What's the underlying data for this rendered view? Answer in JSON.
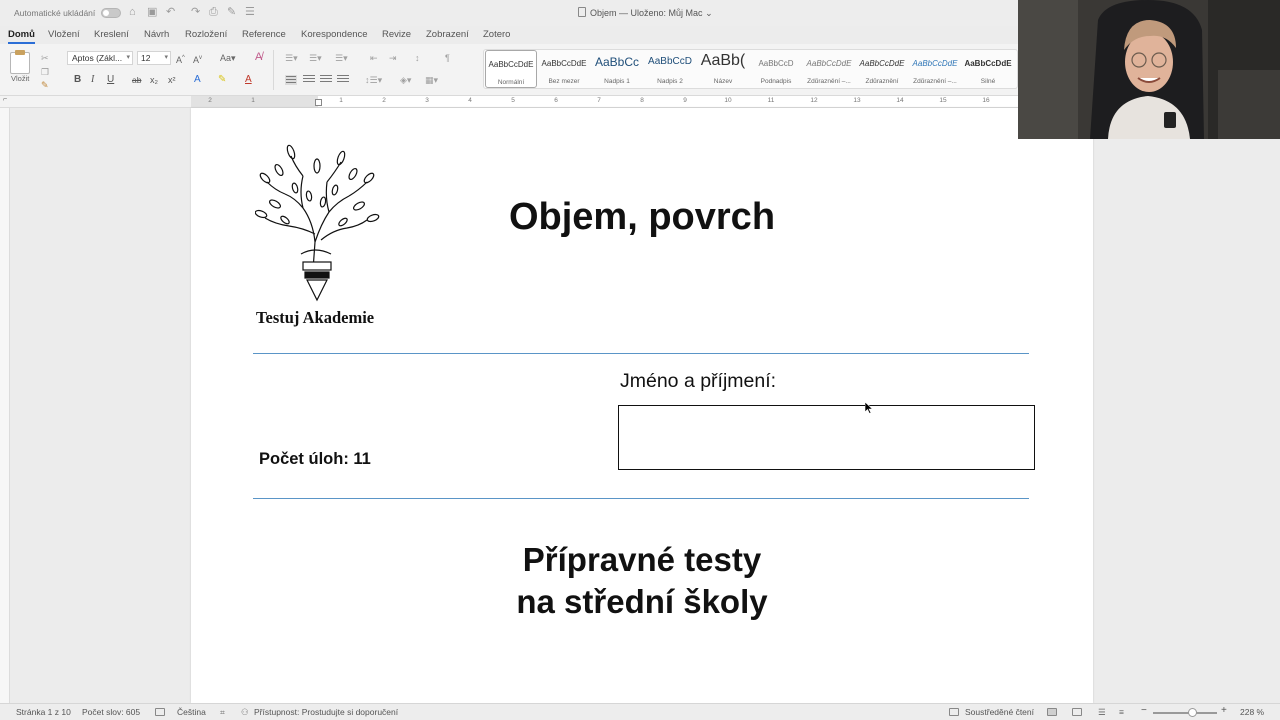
{
  "titlebar": {
    "autosave_label": "Automatické ukládání",
    "document_title": "Objem — Uloženo: Můj Mac",
    "dropdown_glyph": "⌄"
  },
  "ribbon_tabs": [
    "Domů",
    "Vložení",
    "Kreslení",
    "Návrh",
    "Rozložení",
    "Reference",
    "Korespondence",
    "Revize",
    "Zobrazení",
    "Zotero"
  ],
  "ribbon": {
    "paste_label": "Vložit",
    "font_name": "Aptos (Zákl...",
    "font_size": "12",
    "format_buttons": [
      "B",
      "I",
      "U",
      "ab",
      "x₂",
      "x²"
    ],
    "styles": [
      {
        "preview": "AaBbCcDdE",
        "name": "Normální"
      },
      {
        "preview": "AaBbCcDdE",
        "name": "Bez mezer"
      },
      {
        "preview": "AaBbCc",
        "name": "Nadpis 1"
      },
      {
        "preview": "AaBbCcD",
        "name": "Nadpis 2"
      },
      {
        "preview": "AaBb(",
        "name": "Název"
      },
      {
        "preview": "AaBbCcD",
        "name": "Podnadpis"
      },
      {
        "preview": "AaBbCcDdE",
        "name": "Zdůraznění –..."
      },
      {
        "preview": "AaBbCcDdE",
        "name": "Zdůraznění"
      },
      {
        "preview": "AaBbCcDdE",
        "name": "Zdůraznění –..."
      },
      {
        "preview": "AaBbCcDdE",
        "name": "Silné"
      }
    ]
  },
  "ruler": {
    "numbers": [
      "2",
      "1",
      "1",
      "2",
      "3",
      "4",
      "5",
      "6",
      "7",
      "8",
      "9",
      "10",
      "11",
      "12",
      "13",
      "14",
      "15",
      "16"
    ]
  },
  "document": {
    "logo_text": "Testuj Akademie",
    "title": "Objem, povrch",
    "name_label": "Jméno a příjmení:",
    "task_count": "Počet úloh: 11",
    "subtitle_line1": "Přípravné testy",
    "subtitle_line2": "na střední školy"
  },
  "statusbar": {
    "page": "Stránka 1 z 10",
    "word_count": "Počet slov: 605",
    "language": "Čeština",
    "accessibility": "Přístupnost: Prostudujte si doporučení",
    "focus": "Soustředěné čtení",
    "zoom": "228 %",
    "zoom_minus": "−",
    "zoom_plus": "+"
  },
  "colors": {
    "accent": "#2b6ed6",
    "rule": "#5a95c7"
  }
}
